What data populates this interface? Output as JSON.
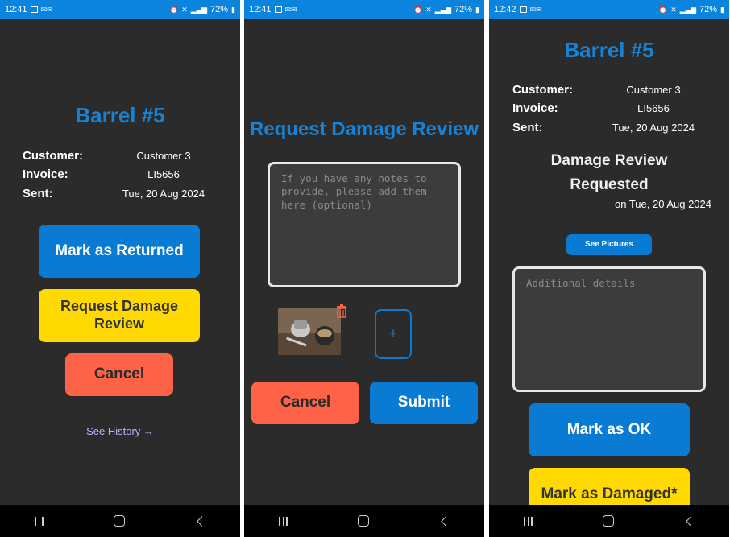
{
  "status": {
    "p1": {
      "time": "12:41",
      "battery": "72%"
    },
    "p2": {
      "time": "12:41",
      "battery": "72%"
    },
    "p3": {
      "time": "12:42",
      "battery": "72%"
    }
  },
  "screen1": {
    "title": "Barrel #5",
    "customer_label": "Customer:",
    "customer_value": "Customer 3",
    "invoice_label": "Invoice:",
    "invoice_value": "LI5656",
    "sent_label": "Sent:",
    "sent_value": "Tue, 20 Aug 2024",
    "mark_returned": "Mark as Returned",
    "request_damage": "Request Damage Review",
    "cancel": "Cancel",
    "history_link": "See History →"
  },
  "screen2": {
    "title": "Request Damage Review",
    "notes_placeholder": "If you have any notes to provide, please add them here (optional)",
    "add_photo": "+",
    "cancel": "Cancel",
    "submit": "Submit"
  },
  "screen3": {
    "title": "Barrel #5",
    "customer_label": "Customer:",
    "customer_value": "Customer 3",
    "invoice_label": "Invoice:",
    "invoice_value": "LI5656",
    "sent_label": "Sent:",
    "sent_value": "Tue, 20 Aug 2024",
    "status_heading": "Damage Review Requested",
    "status_date": "on Tue, 20 Aug 2024",
    "see_pictures": "See Pictures",
    "details_placeholder": "Additional details",
    "mark_ok": "Mark as OK",
    "mark_damaged": "Mark as Damaged*"
  },
  "colors": {
    "accent": "#0a7bd3",
    "warning": "#ffd900",
    "danger": "#ff6347",
    "background": "#2b2b2b",
    "status_bar": "#0a84dc"
  }
}
